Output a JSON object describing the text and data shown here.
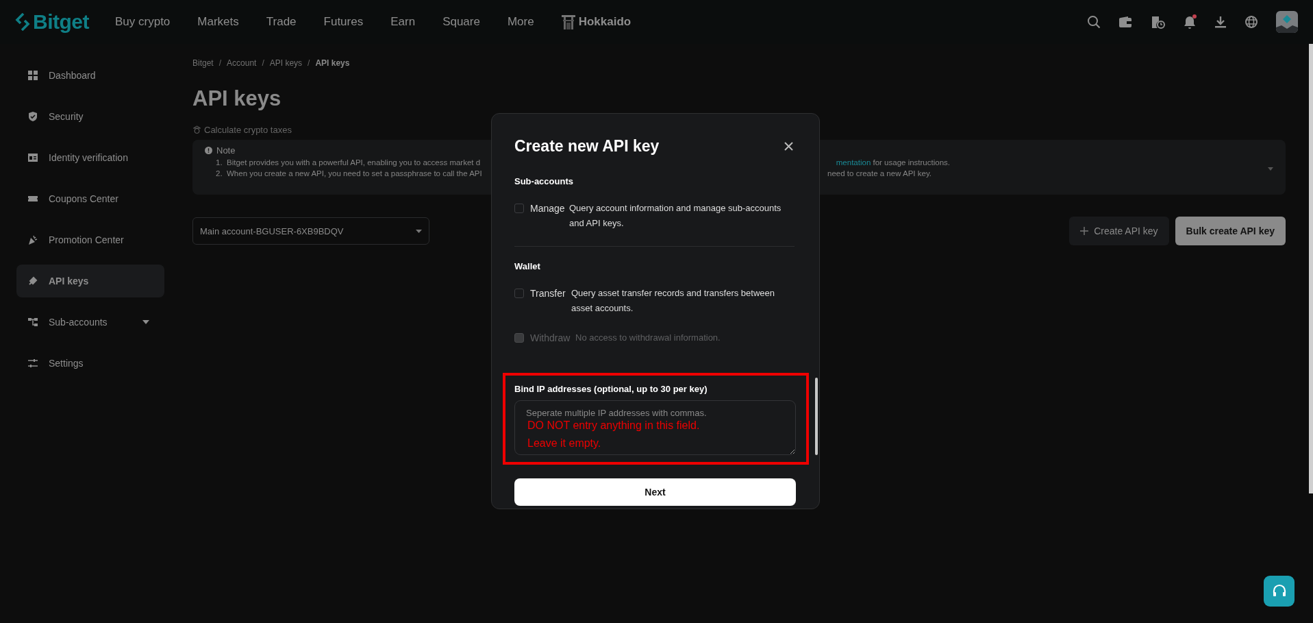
{
  "nav": {
    "logo": "Bitget",
    "items": [
      "Buy crypto",
      "Markets",
      "Trade",
      "Futures",
      "Earn",
      "Square",
      "More"
    ],
    "promo": "Hokkaido"
  },
  "sidebar": {
    "items": [
      {
        "label": "Dashboard",
        "selected": false
      },
      {
        "label": "Security",
        "selected": false
      },
      {
        "label": "Identity verification",
        "selected": false
      },
      {
        "label": "Coupons Center",
        "selected": false
      },
      {
        "label": "Promotion Center",
        "selected": false
      },
      {
        "label": "API keys",
        "selected": true
      },
      {
        "label": "Sub-accounts",
        "selected": false,
        "expanded": false
      },
      {
        "label": "Settings",
        "selected": false
      }
    ]
  },
  "breadcrumb_separator": "/",
  "breadcrumb": [
    {
      "label": "Bitget",
      "current": false
    },
    {
      "label": "Account",
      "current": false
    },
    {
      "label": "API keys",
      "current": false
    },
    {
      "label": "API keys",
      "current": true
    }
  ],
  "page_title": "API keys",
  "tax_link": "Calculate crypto taxes",
  "note": {
    "title": "Note",
    "lines": [
      {
        "number": "1.",
        "left": "Bitget provides you with a powerful API, enabling you to access market d",
        "link": "mentation",
        "right": " for usage instructions."
      },
      {
        "number": "2.",
        "left": "When you create a new API, you need to set a passphrase to call the API",
        "right": "need to create a new API key."
      }
    ]
  },
  "account_select": {
    "value": "Main account-BGUSER-6XB9BDQV"
  },
  "buttons": [
    {
      "label": "Create API key",
      "kind": "secondary"
    },
    {
      "label": "Bulk create API key",
      "kind": "primary"
    }
  ],
  "modal": {
    "title": "Create new API key",
    "sections": [
      {
        "title": "Sub-accounts",
        "permissions": [
          {
            "label": "Manage",
            "description": "Query account information and manage sub-accounts and API keys.",
            "checked": false,
            "disabled": false
          }
        ]
      },
      {
        "title": "Wallet",
        "permissions": [
          {
            "label": "Transfer",
            "description": "Query asset transfer records and transfers between asset accounts.",
            "checked": false,
            "disabled": false
          },
          {
            "label": "Withdraw",
            "description": "No access to withdrawal information.",
            "checked": false,
            "disabled": true
          }
        ]
      }
    ],
    "ip_field": {
      "label": "Bind IP addresses (optional, up to 30 per key)",
      "placeholder": "Seperate multiple IP addresses with commas.",
      "annotations": [
        "DO NOT entry anything in this field.",
        "Leave it empty."
      ]
    },
    "next_button": "Next"
  }
}
